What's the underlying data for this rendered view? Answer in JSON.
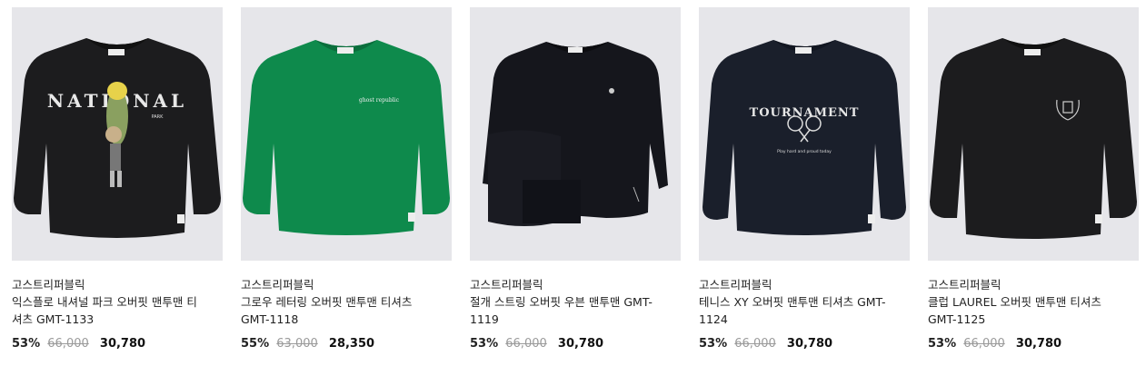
{
  "products": [
    {
      "brand": "고스트리퍼블릭",
      "name": "익스플로 내셔널 파크 오버핏 맨투맨 티셔츠 GMT-1133",
      "discount": "53%",
      "original_price": "66,000",
      "sale_price": "30,780",
      "garment_color": "#1c1c1e",
      "print": "NATIONAL",
      "print_sub": "PARK"
    },
    {
      "brand": "고스트리퍼블릭",
      "name": "그로우 레터링 오버핏 맨투맨 티셔츠 GMT-1118",
      "discount": "55%",
      "original_price": "63,000",
      "sale_price": "28,350",
      "garment_color": "#0e8a4c",
      "print": "ghost republic"
    },
    {
      "brand": "고스트리퍼블릭",
      "name": "절개 스트링 오버핏 우븐 맨투맨 GMT-1119",
      "discount": "53%",
      "original_price": "66,000",
      "sale_price": "30,780",
      "garment_color": "#15161c"
    },
    {
      "brand": "고스트리퍼블릭",
      "name": "테니스 XY 오버핏 맨투맨 티셔츠 GMT-1124",
      "discount": "53%",
      "original_price": "66,000",
      "sale_price": "30,780",
      "garment_color": "#1a1f2b",
      "print": "TOURNAMENT",
      "print_sub": "Play hard and proud today"
    },
    {
      "brand": "고스트리퍼블릭",
      "name": "클럽 LAUREL 오버핏 맨투맨 티셔츠 GMT-1125",
      "discount": "53%",
      "original_price": "66,000",
      "sale_price": "30,780",
      "garment_color": "#1c1c1e"
    }
  ]
}
